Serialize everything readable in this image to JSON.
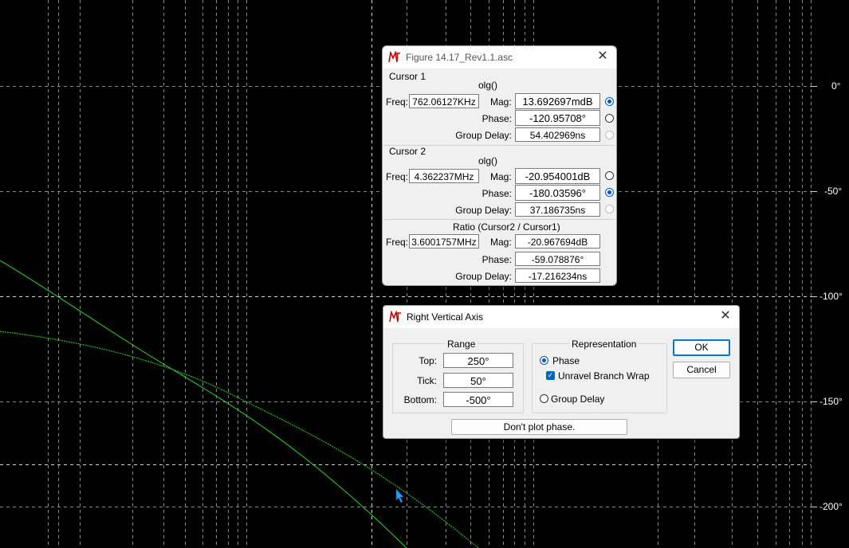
{
  "plot": {
    "bg": "#000000",
    "grid_color": "#8a8a8a",
    "trace_color": "#22dd22",
    "axis_labels": [
      "0°",
      "-50°",
      "-100°",
      "-150°",
      "-200°"
    ]
  },
  "cursor_dialog": {
    "title": "Figure 14.17_Rev1.1.asc",
    "cursor1": {
      "header": "Cursor 1",
      "expr": "olg()",
      "freq_label": "Freq:",
      "freq": "762.06127KHz",
      "mag_label": "Mag:",
      "mag": "13.692697mdB",
      "phase_label": "Phase:",
      "phase": "-120.95708°",
      "gd_label": "Group Delay:",
      "gd": "54.402969ns"
    },
    "cursor2": {
      "header": "Cursor 2",
      "expr": "olg()",
      "freq_label": "Freq:",
      "freq": "4.362237MHz",
      "mag_label": "Mag:",
      "mag": "-20.954001dB",
      "phase_label": "Phase:",
      "phase": "-180.03596°",
      "gd_label": "Group Delay:",
      "gd": "37.186735ns"
    },
    "ratio": {
      "header": "Ratio (Cursor2 / Cursor1)",
      "freq_label": "Freq:",
      "freq": "3.6001757MHz",
      "mag_label": "Mag:",
      "mag": "-20.967694dB",
      "phase_label": "Phase:",
      "phase": "-59.078876°",
      "gd_label": "Group Delay:",
      "gd": "-17.216234ns"
    }
  },
  "axis_dialog": {
    "title": "Right Vertical Axis",
    "range": {
      "header": "Range",
      "top_label": "Top:",
      "top": "250°",
      "tick_label": "Tick:",
      "tick": "50°",
      "bottom_label": "Bottom:",
      "bottom": "-500°"
    },
    "representation": {
      "header": "Representation",
      "phase_label": "Phase",
      "unravel_label": "Unravel Branch Wrap",
      "group_delay_label": "Group Delay"
    },
    "ok_label": "OK",
    "cancel_label": "Cancel",
    "dont_plot_label": "Don't plot phase."
  }
}
